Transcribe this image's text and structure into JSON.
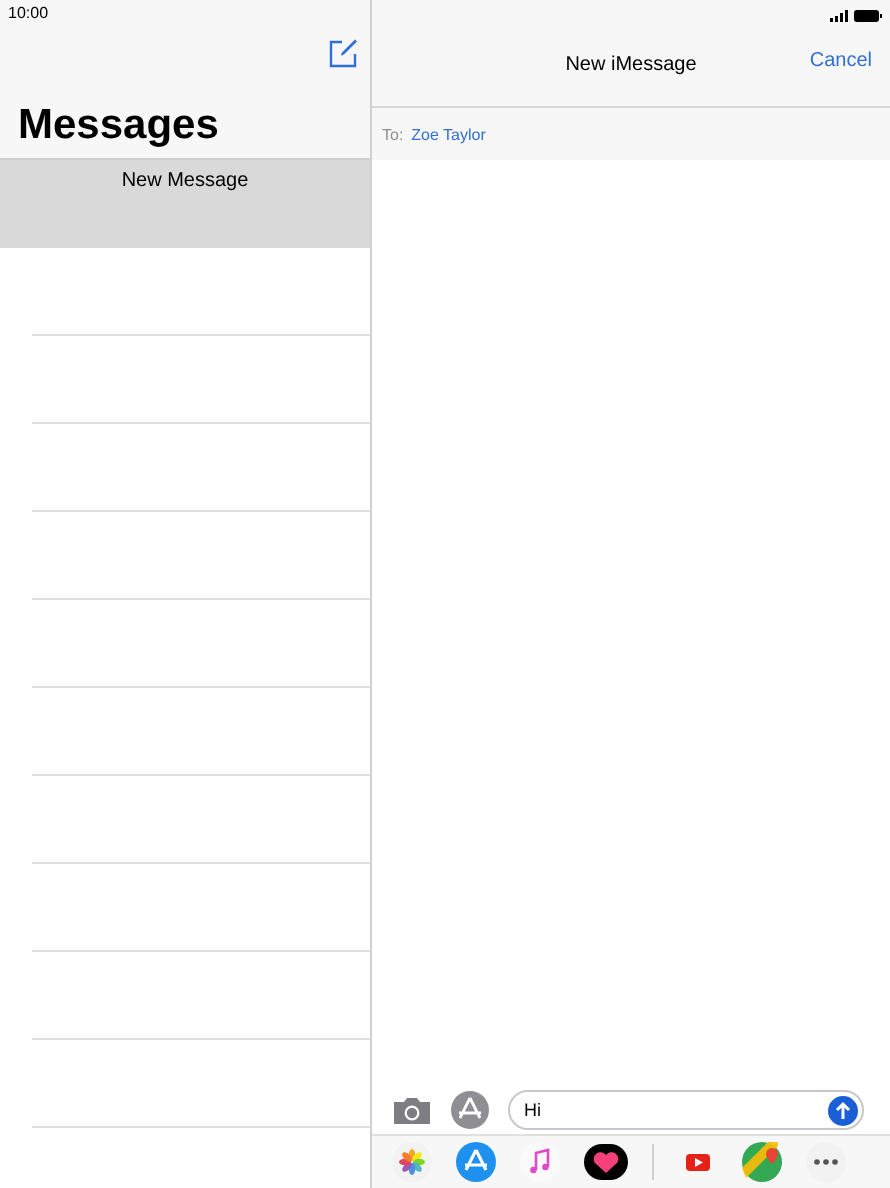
{
  "status_bar": {
    "time": "10:00"
  },
  "sidebar": {
    "title": "Messages",
    "conversations": [
      {
        "title": "New Message",
        "selected": true
      }
    ]
  },
  "compose": {
    "title": "New iMessage",
    "cancel": "Cancel",
    "to_label": "To:",
    "recipient": "Zoe Taylor",
    "message": {
      "value": "Hi"
    }
  }
}
